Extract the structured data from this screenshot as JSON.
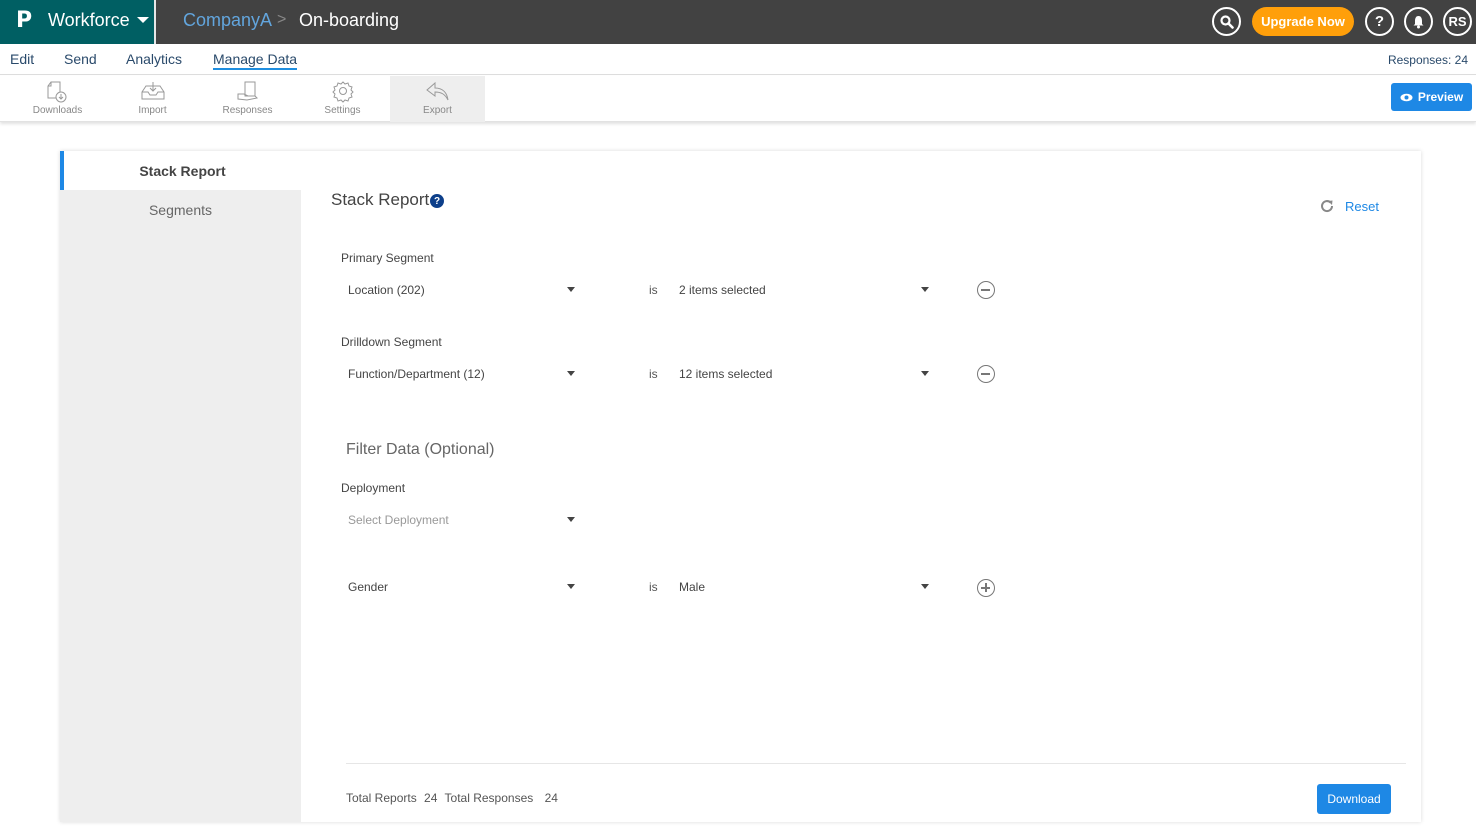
{
  "header": {
    "logo": "P",
    "app_name": "Workforce",
    "breadcrumb": {
      "company": "CompanyA",
      "separator": ">",
      "page": "On-boarding"
    },
    "upgrade_label": "Upgrade Now",
    "help_label": "?",
    "avatar_initials": "RS",
    "colors": {
      "brand": "#005f63",
      "topbar": "#424242",
      "upgrade": "#ff9f0a"
    }
  },
  "menu": {
    "items": [
      {
        "label": "Edit"
      },
      {
        "label": "Send"
      },
      {
        "label": "Analytics"
      },
      {
        "label": "Manage Data",
        "active": true
      }
    ],
    "responses_count": "Responses: 24"
  },
  "toolbar": {
    "tools": [
      {
        "label": "Downloads",
        "icon": "file-download-icon"
      },
      {
        "label": "Import",
        "icon": "inbox-import-icon"
      },
      {
        "label": "Responses",
        "icon": "hand-document-icon"
      },
      {
        "label": "Settings",
        "icon": "gear-icon"
      },
      {
        "label": "Export",
        "icon": "reply-arrow-icon",
        "active": true
      }
    ],
    "preview_label": "Preview"
  },
  "sidebar": {
    "items": [
      {
        "label": "Stack Report",
        "active": true
      },
      {
        "label": "Segments"
      }
    ]
  },
  "main": {
    "title": "Stack Report",
    "help": "?",
    "reset_label": "Reset",
    "primary_segment": {
      "label": "Primary Segment",
      "field": "Location (202)",
      "operator": "is",
      "value": "2 items selected"
    },
    "drilldown_segment": {
      "label": "Drilldown Segment",
      "field": "Function/Department (12)",
      "operator": "is",
      "value": "12 items selected"
    },
    "filter": {
      "title": "Filter Data (Optional)",
      "deployment_label": "Deployment",
      "deployment_placeholder": "Select Deployment",
      "gender_field": "Gender",
      "gender_operator": "is",
      "gender_value": "Male"
    },
    "footer": {
      "total_reports_label": "Total Reports",
      "total_reports": "24",
      "total_responses_label": "Total Responses",
      "total_responses": "24",
      "download_label": "Download"
    },
    "accent_color": "#1e88e5"
  }
}
